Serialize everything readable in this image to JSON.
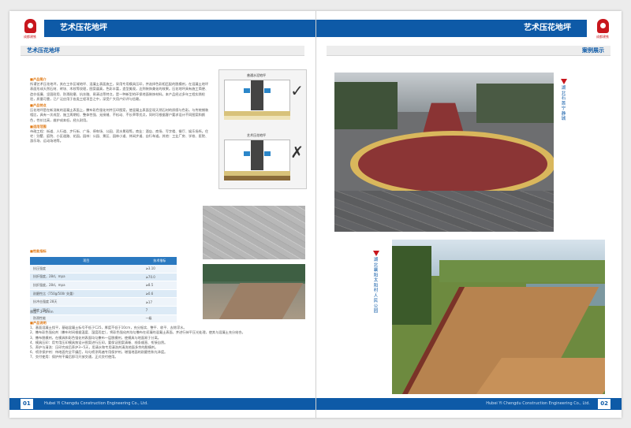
{
  "brand": {
    "logo_text": "成都建铁"
  },
  "header": {
    "left_title": "艺术压花地坪",
    "right_title": "艺术压花地坪"
  },
  "left": {
    "subhead": "艺术压花地坪",
    "sections": [
      {
        "heading": "■产品简介",
        "body": "所谓艺术压花地坪，其在工作区域地坪、混凝土表面施工，采用专用模具压印，并选择色彩相匹配的脱模剂，在混凝土地坪表面形成天然石材、砖块、木纹等纹理，图案逼真，色彩丰富，造型美观，达到装饰美化的效果。压花地坪具有施工简便、造价低廉、坚固耐用、防滑耐磨、抗冻融、易清洁等特点，是一种新型的环保地面装饰材料。本产品经过多年工程实践检验，质量可靠，已广泛应用于各类工程项目之中，深受广大用户好评与信赖。"
      },
      {
        "heading": "■产品特点",
        "body": "压花地坪是在新浇筑的混凝土表面上，撒布彩色强化剂并压印图案，使混凝土表面呈现天然石材的质感与色彩。与传统铺装相比，具有一次成型、施工周期短、整体性强、无接缝、不松动、不长草等优点，同时可根据客户要求设计不同图案和颜色，性价比高，维护成本低，经久耐用。"
      },
      {
        "heading": "■适用范围",
        "body": "市政工程：街道、人行道、步行街、广场、停车场、公园、滨水景观等。商业：酒店、商场、写字楼、餐厅、娱乐场所。住宅：别墅、庭院、小区道路、花园。园林：公园、景区、园林小道、休闲步道、自行车道。其他：工业厂房、学校、医院、游乐场、运动场地等。"
      }
    ],
    "diagram": {
      "top_label": "普通水泥地坪",
      "bottom_label": "艺术压花地坪"
    },
    "perf_heading": "■性能指标",
    "perf_table": {
      "headers": [
        "项目",
        "技术指标"
      ],
      "rows": [
        [
          "抗压强度",
          "≥3.10"
        ],
        [
          "抗折强度，28d，mpa",
          "≥70.0"
        ],
        [
          "抗折强度，28d，mpa",
          "≥8.5"
        ],
        [
          "耐磨性比（750g/500r 失重）",
          "≥0.6"
        ],
        [
          "抗冲击强度 28天",
          "≥17"
        ],
        [
          "硬度（莫氏）",
          "7"
        ],
        [
          "防滑性能",
          "一级"
        ]
      ],
      "note": "厚度：3~5mm"
    },
    "process_heading": "■产品说明",
    "process_lines": [
      "1、基面混凝土找平，基础混凝土标号不低于C25，厚度不低于10cm，充分振实、整平、收平、去除浮水。",
      "2、撒布彩色强化剂（撒布时间根据温度、湿度而定），将彩色强化剂均匀撒布在初凝的混凝土表面，并进行抹平压光处理，使其与混凝土充分结合。",
      "3、撒布脱模剂，在模具和彩色强化剂表面均匀撒布一层脱模剂，使模具与地面易于分离。",
      "4、模具压印：用专用压印模具按设计图案进行压印，要保证图案清晰、线条顺直、衔接自然。",
      "5、养护与清洗：压印完成后养护3~5天，用清水和专用清洗剂清洗地面多余的脱模剂。",
      "6、喷涂保护剂：待地面完全干燥后，均匀喷涂两遍专用保护剂，增强地面的耐磨性和光泽度。",
      "7、交付使用：保护剂干燥后即可开放交通，正式交付使用。"
    ]
  },
  "right": {
    "subhead": "案例展示",
    "case1_caption": "湖北石首宁静城",
    "case2_caption": "湖北襄阳太阳村人民公园"
  },
  "footer": {
    "left_page": "01",
    "right_page": "02",
    "company": "Hubei Yi Chengdu Construction Engineering Co., Ltd."
  },
  "colors": {
    "brand_blue": "#0e5aa7",
    "brand_red": "#c8161d",
    "heading_orange": "#e07a16"
  }
}
